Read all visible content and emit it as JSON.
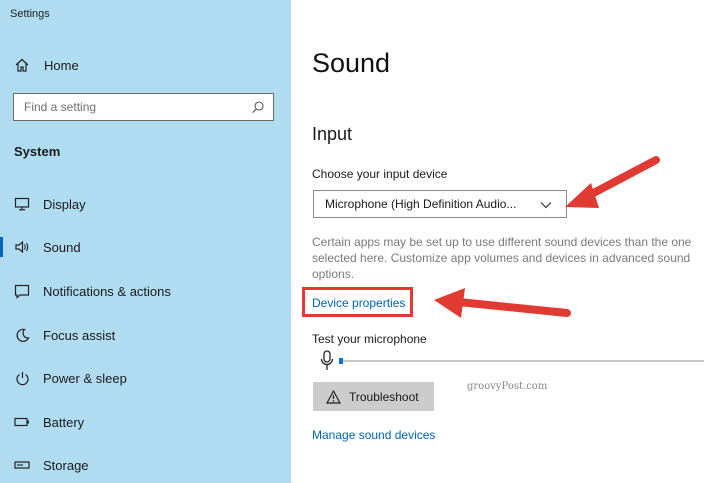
{
  "app": {
    "title": "Settings"
  },
  "sidebar": {
    "home_label": "Home",
    "search_placeholder": "Find a setting",
    "section": "System",
    "items": [
      {
        "label": "Display",
        "icon": "monitor-icon"
      },
      {
        "label": "Sound",
        "icon": "speaker-icon",
        "active": true
      },
      {
        "label": "Notifications & actions",
        "icon": "notification-icon"
      },
      {
        "label": "Focus assist",
        "icon": "moon-icon"
      },
      {
        "label": "Power & sleep",
        "icon": "power-icon"
      },
      {
        "label": "Battery",
        "icon": "battery-icon"
      },
      {
        "label": "Storage",
        "icon": "storage-icon"
      }
    ]
  },
  "main": {
    "title": "Sound",
    "input_heading": "Input",
    "device_label": "Choose your input device",
    "device_value": "Microphone (High Definition Audio...",
    "description": "Certain apps may be set up to use different sound devices than the one selected here. Customize app volumes and devices in advanced sound options.",
    "device_properties_link": "Device properties",
    "test_label": "Test your microphone",
    "mic_level": 0.01,
    "troubleshoot_label": "Troubleshoot",
    "manage_link": "Manage sound devices",
    "watermark": "groovyPost.com"
  },
  "colors": {
    "sidebar": "#b0dcf2",
    "link": "#0063b1",
    "accent": "#0078d4",
    "annotation": "#e03a32"
  }
}
